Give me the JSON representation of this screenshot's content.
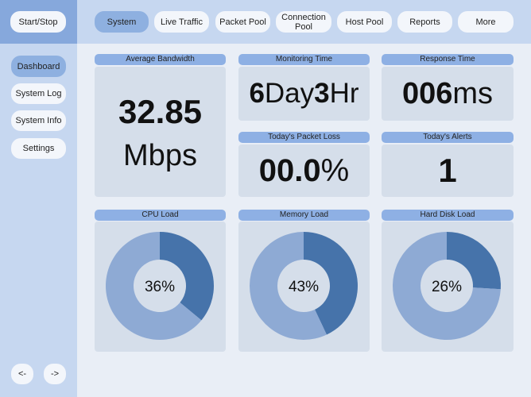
{
  "start_stop": "Start/Stop",
  "tabs": [
    {
      "label": "System",
      "active": true
    },
    {
      "label": "Live Traffic"
    },
    {
      "label": "Packet Pool"
    },
    {
      "label": "Connection Pool"
    },
    {
      "label": "Host Pool"
    },
    {
      "label": "Reports"
    },
    {
      "label": "More"
    }
  ],
  "sidebar": {
    "items": [
      {
        "label": "Dashboard",
        "active": true
      },
      {
        "label": "System Log"
      },
      {
        "label": "System Info"
      },
      {
        "label": "Settings"
      }
    ],
    "back": "<-",
    "forward": "->"
  },
  "cards": {
    "bandwidth": {
      "title": "Average Bandwidth",
      "value": "32.85",
      "unit": "Mbps"
    },
    "monitoring": {
      "title": "Monitoring Time",
      "days": "6",
      "days_unit": "Day",
      "hours": "3",
      "hours_unit": "Hr"
    },
    "response": {
      "title": "Response Time",
      "value": "006",
      "unit": "ms"
    },
    "packet_loss": {
      "title": "Today's Packet Loss",
      "value": "00.0",
      "unit": "%"
    },
    "alerts": {
      "title": "Today's Alerts",
      "value": "1"
    }
  },
  "colors": {
    "used": "#4673aa",
    "free": "#8eaad4",
    "hole": "#d5deea"
  },
  "chart_data": [
    {
      "type": "pie",
      "title": "CPU Load",
      "values": [
        36,
        64
      ],
      "label": "36%"
    },
    {
      "type": "pie",
      "title": "Memory Load",
      "values": [
        43,
        57
      ],
      "label": "43%"
    },
    {
      "type": "pie",
      "title": "Hard Disk Load",
      "values": [
        26,
        74
      ],
      "label": "26%"
    }
  ]
}
